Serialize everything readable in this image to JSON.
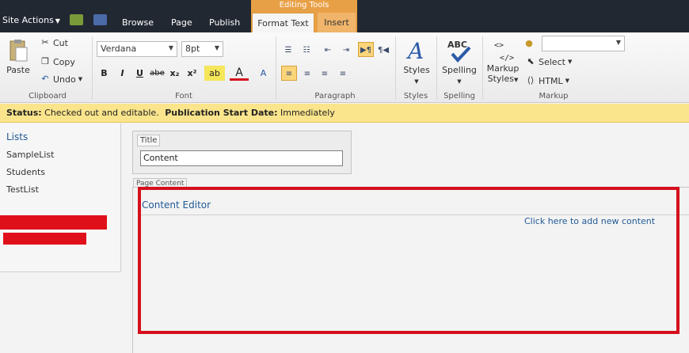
{
  "topbar": {
    "site_actions": "Site Actions",
    "contextual_group": "Editing Tools",
    "tabs": [
      "Browse",
      "Page",
      "Publish"
    ],
    "active_tab": "Format Text",
    "insert_tab": "Insert"
  },
  "ribbon": {
    "clipboard": {
      "paste": "Paste",
      "cut": "Cut",
      "copy": "Copy",
      "undo": "Undo",
      "label": "Clipboard"
    },
    "font": {
      "family": "Verdana",
      "size": "8pt",
      "label": "Font",
      "bold": "B",
      "italic": "I",
      "underline": "U",
      "strike": "abe",
      "sub": "x₂",
      "sup": "x²",
      "highlight": "ab",
      "color": "A"
    },
    "paragraph": {
      "label": "Paragraph"
    },
    "styles": {
      "button": "Styles",
      "label": "Styles"
    },
    "spelling": {
      "button": "Spelling",
      "icon_text": "ABC",
      "label": "Spelling"
    },
    "markup": {
      "markup_styles_1": "Markup",
      "markup_styles_2": "Styles",
      "select": "Select",
      "html": "HTML",
      "label": "Markup"
    }
  },
  "status": {
    "label": "Status:",
    "value": "Checked out and editable.",
    "pub_label": "Publication Start Date:",
    "pub_value": "Immediately"
  },
  "leftnav": {
    "heading": "Lists",
    "items": [
      "SampleList",
      "Students",
      "TestList"
    ]
  },
  "main": {
    "title_label": "Title",
    "title_value": "Content",
    "page_content_tab": "Page Content",
    "content_editor_title": "Content Editor",
    "add_content_link": "Click here to add new content"
  },
  "colors": {
    "accent_tab": "#e8a046",
    "status_bg": "#fbe58c",
    "link": "#215a96",
    "annotation": "#d4101c"
  }
}
